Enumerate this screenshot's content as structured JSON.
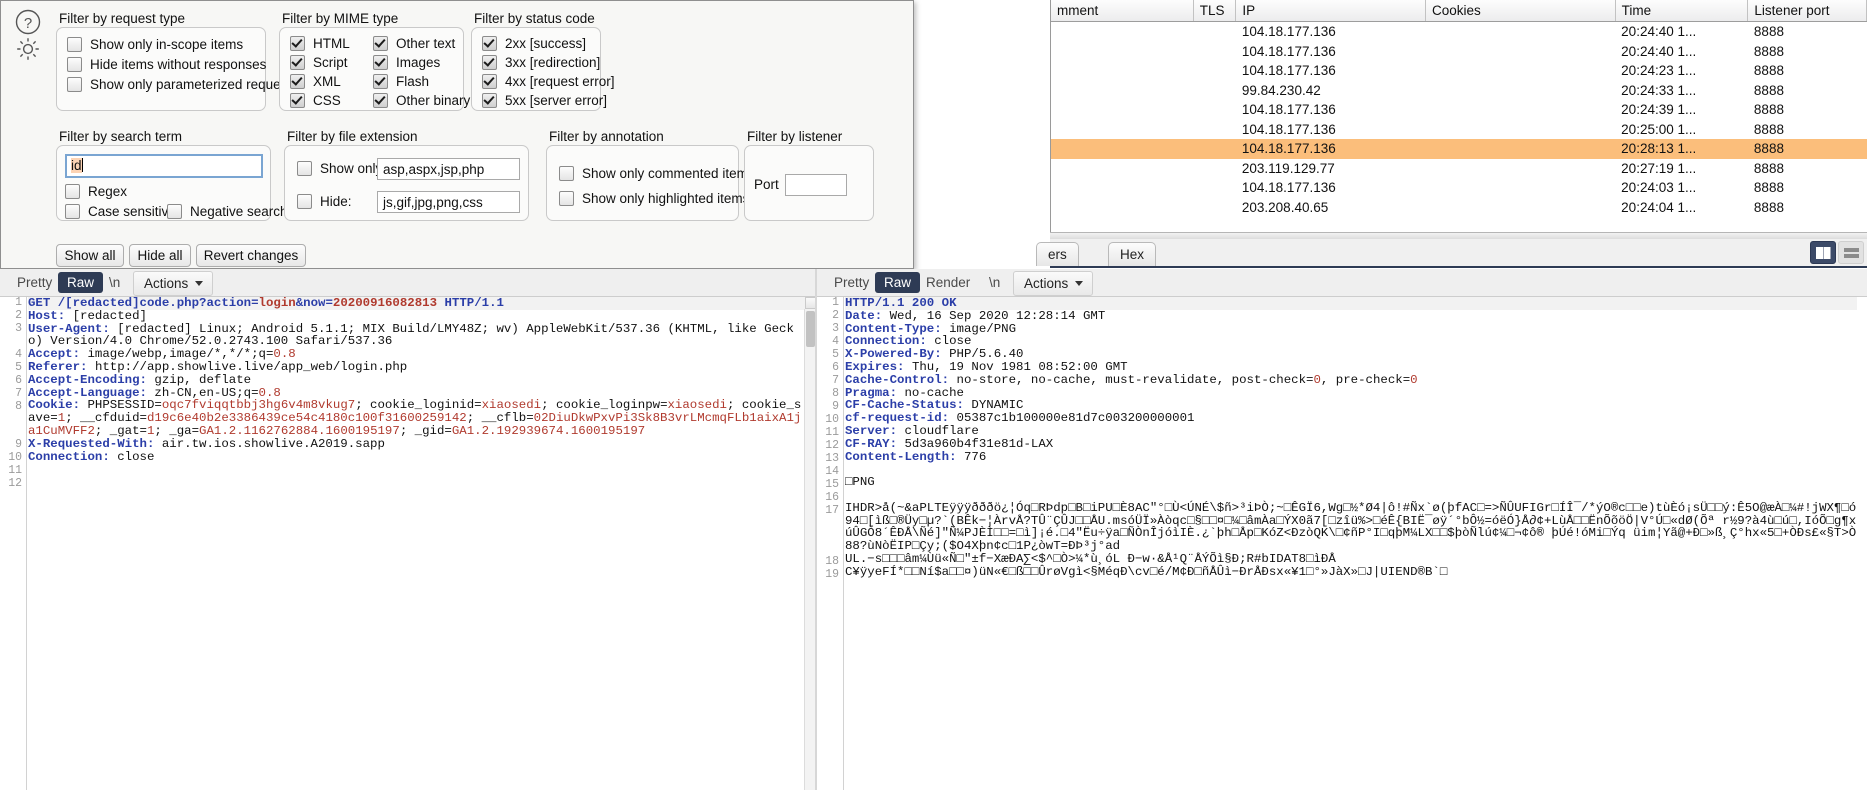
{
  "history": {
    "columns": [
      "mment",
      "TLS",
      "IP",
      "Cookies",
      "Time",
      "Listener port"
    ],
    "rows": [
      {
        "comment": "",
        "tls": "",
        "ip": "104.18.177.136",
        "cookies": "",
        "time": "20:24:40 1...",
        "port": "8888",
        "selected": false
      },
      {
        "comment": "",
        "tls": "",
        "ip": "104.18.177.136",
        "cookies": "",
        "time": "20:24:40 1...",
        "port": "8888",
        "selected": false
      },
      {
        "comment": "",
        "tls": "",
        "ip": "104.18.177.136",
        "cookies": "",
        "time": "20:24:23 1...",
        "port": "8888",
        "selected": false
      },
      {
        "comment": "",
        "tls": "",
        "ip": "99.84.230.42",
        "cookies": "",
        "time": "20:24:33 1...",
        "port": "8888",
        "selected": false
      },
      {
        "comment": "",
        "tls": "",
        "ip": "104.18.177.136",
        "cookies": "",
        "time": "20:24:39 1...",
        "port": "8888",
        "selected": false
      },
      {
        "comment": "",
        "tls": "",
        "ip": "104.18.177.136",
        "cookies": "",
        "time": "20:25:00 1...",
        "port": "8888",
        "selected": false
      },
      {
        "comment": "",
        "tls": "",
        "ip": "104.18.177.136",
        "cookies": "",
        "time": "20:28:13 1...",
        "port": "8888",
        "selected": true
      },
      {
        "comment": "",
        "tls": "",
        "ip": "203.119.129.77",
        "cookies": "",
        "time": "20:27:19 1...",
        "port": "8888",
        "selected": false
      },
      {
        "comment": "",
        "tls": "",
        "ip": "104.18.177.136",
        "cookies": "",
        "time": "20:24:03 1...",
        "port": "8888",
        "selected": false
      },
      {
        "comment": "",
        "tls": "",
        "ip": "203.208.40.65",
        "cookies": "",
        "time": "20:24:04 1...",
        "port": "8888",
        "selected": false
      }
    ],
    "selected_row_color": "#fbbe7b"
  },
  "response_subtabs": {
    "headers_label": "ers",
    "hex_label": "Hex",
    "active": "Hex"
  },
  "layout_toggles": {
    "split_icon": "split-view-icon",
    "stack_icon": "stacked-view-icon",
    "active": "split",
    "active_color": "#3c4a68"
  },
  "filter_popup": {
    "help_icon": "help-icon",
    "settings_icon": "gear-icon",
    "request_type": {
      "legend": "Filter by request type",
      "items": [
        {
          "label": "Show only in-scope items",
          "checked": false
        },
        {
          "label": "Hide items without responses",
          "checked": false
        },
        {
          "label": "Show only parameterized requests",
          "checked": false
        }
      ]
    },
    "mime_type": {
      "legend": "Filter by MIME type",
      "left": [
        {
          "label": "HTML",
          "checked": true
        },
        {
          "label": "Script",
          "checked": true
        },
        {
          "label": "XML",
          "checked": true
        },
        {
          "label": "CSS",
          "checked": true
        }
      ],
      "right": [
        {
          "label": "Other text",
          "checked": true
        },
        {
          "label": "Images",
          "checked": true
        },
        {
          "label": "Flash",
          "checked": true
        },
        {
          "label": "Other binary",
          "checked": true
        }
      ]
    },
    "status_code": {
      "legend": "Filter by status code",
      "items": [
        {
          "label": "2xx  [success]",
          "checked": true
        },
        {
          "label": "3xx  [redirection]",
          "checked": true
        },
        {
          "label": "4xx  [request error]",
          "checked": true
        },
        {
          "label": "5xx  [server error]",
          "checked": true
        }
      ]
    },
    "search_term": {
      "legend": "Filter by search term",
      "value": "id",
      "options": [
        {
          "label": "Regex",
          "checked": false
        },
        {
          "label": "Case sensitive",
          "checked": false
        },
        {
          "label": "Negative search",
          "checked": false
        }
      ]
    },
    "file_extension": {
      "legend": "Filter by file extension",
      "show_only_label": "Show only:",
      "show_only_checked": false,
      "show_only_value": "asp,aspx,jsp,php",
      "hide_label": "Hide:",
      "hide_checked": false,
      "hide_value": "js,gif,jpg,png,css"
    },
    "annotation": {
      "legend": "Filter by annotation",
      "items": [
        {
          "label": "Show only commented items",
          "checked": false
        },
        {
          "label": "Show only highlighted items",
          "checked": false
        }
      ]
    },
    "listener": {
      "legend": "Filter by listener",
      "port_label": "Port",
      "port_value": ""
    },
    "buttons": {
      "show_all": "Show all",
      "hide_all": "Hide all",
      "revert": "Revert changes"
    }
  },
  "request_panel": {
    "tabs": {
      "pretty": "Pretty",
      "raw": "Raw",
      "newline": "\\n",
      "actions": "Actions",
      "active": "Raw"
    },
    "line_numbers": [
      "1",
      "2",
      "3",
      "4",
      "5",
      "6",
      "7",
      "8",
      "9",
      "10",
      "11",
      "12"
    ],
    "lines": [
      "GET /[redacted]code.php?action=login&now=20200916082813 HTTP/1.1",
      "Host: [redacted]",
      "User-Agent: [redacted] Linux; Android 5.1.1; MIX Build/LMY48Z; wv) AppleWebKit/537.36 (KHTML, like Gecko) Version/4.0 Chrome/52.0.2743.100 Safari/537.36",
      "Accept: image/webp,image/*,*/*;q=0.8",
      "Referer: http://app.showlive.live/app_web/login.php",
      "Accept-Encoding: gzip, deflate",
      "Accept-Language: zh-CN,en-US;q=0.8",
      "Cookie: PHPSESSID=oqc7fviqqtbbj3hg6v4m8vkug7; cookie_loginid=xiaosedi; cookie_loginpw=xiaosedi; cookie_save=1; __cfduid=d19c6e40b2e3386439ce54c4180c100f31600259142; __cflb=02DiuDkwPxvPi3Sk8B3vrLMcmqFLb1aixA1ja1CuMVFF2; _gat=1; _ga=GA1.2.1162762884.1600195197; _gid=GA1.2.192939674.1600195197",
      "X-Requested-With: air.tw.ios.showlive.A2019.sapp",
      "Connection: close",
      "",
      ""
    ]
  },
  "response_panel": {
    "tabs": {
      "pretty": "Pretty",
      "raw": "Raw",
      "render": "Render",
      "newline": "\\n",
      "actions": "Actions",
      "active": "Raw"
    },
    "line_numbers": [
      "1",
      "2",
      "3",
      "4",
      "5",
      "6",
      "7",
      "8",
      "9",
      "10",
      "11",
      "12",
      "13",
      "14",
      "15",
      "16",
      "17",
      "18",
      "19"
    ],
    "lines": [
      "HTTP/1.1 200 OK",
      "Date: Wed, 16 Sep 2020 12:28:14 GMT",
      "Content-Type: image/PNG",
      "Connection: close",
      "X-Powered-By: PHP/5.6.40",
      "Expires: Thu, 19 Nov 1981 08:52:00 GMT",
      "Cache-Control: no-store, no-cache, must-revalidate, post-check=0, pre-check=0",
      "Pragma: no-cache",
      "CF-Cache-Status: DYNAMIC",
      "cf-request-id: 05387c1b100000e81d7c003200000001",
      "Server: cloudflare",
      "CF-RAY: 5d3a960b4f31e81d-LAX",
      "Content-Length: 776",
      "",
      "□PNG",
      "",
      "IHDR>å(~&aPLTEÿÿÿðððö¿¦Óq□RÞdp□B□iPU□È8AC\"°□Ù<ÚNÉ\\$ñ>³iÞÒ;~□ÊGÏ6,Wg□½*Ø4|ô!#Ñx`ø(þfAC□=>ÑÛUFIGr□ÍÎ¯/*ýO®c□□e)tùÈó¡sÜ□□ý:Ê5O@æÀ□¼#!jWX¶□ó94□[ìß□®Üy□µ?`(BÊk−¦ÀrvÅ?TÛ¨ÇÛJ□□ÅU.msóÜÏ»Àòqc□§□□¤□¼□âmÀa□ÝX0ã7[□zîü%>□éÊ{BIË¯øÿ´°bÔ½=óëÓ}Å∂¢+LùÅ□□ËnÕõöÖ|V°Ú□«dØ(Õª r½9?à4ù□ú□,IóÕ□g¶xúÛGÒ8´ÊÐÅ\\Ñé]\"Ñ¼PJÈÌ□□=□ì]¡é.□4\"Ëu÷ÿa□ÑÒnÎjóìIÈ.¿`þh□Åp□KóZ<ÐzòQK\\□¢ñP°I□qþM¼LX□□$þòÑlú¢¼□¬¢ô® þÚé!óMi□Ýq üim¦Yã@+Ð□»ß¸Ç°hx«5□+ÒÐs£«§T>Ò88?ùNòËIP□Çy;($O4Xþn¢c□1P¿òwT=ÐÞ³j°ad",
      "UL.−s□□□âm¼Ùü«Ñ□\"±f−XæÐA∑<$^□Ò>¼*ù¸óL Ð−w·&Å¹Q¨ÅÝÕì§Ð;R#bIDAT8□ìÐÅ",
      "C¥ÿyeFÍ*□□Ní$a□□¤)üN«€□ß□□ÛrøVgì<§MéqÐ\\cv□é/M¢Ð□ñÅÛì−ÐrÅÐsx«¥1□°»JàX»□J|UIEND®B`□"
    ]
  }
}
